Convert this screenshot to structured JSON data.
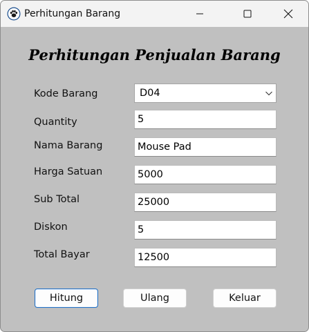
{
  "window": {
    "title": "Perhitungan Barang",
    "icon": "paw-icon",
    "controls": [
      "minimize-icon",
      "maximize-icon",
      "close-icon"
    ]
  },
  "form": {
    "heading": "Perhitungan Penjualan Barang",
    "fields": {
      "kode_barang": {
        "label": "Kode Barang",
        "value": "D04"
      },
      "quantity": {
        "label": "Quantity",
        "value": "5"
      },
      "nama_barang": {
        "label": "Nama Barang",
        "value": "Mouse Pad"
      },
      "harga_satuan": {
        "label": "Harga Satuan",
        "value": "5000"
      },
      "sub_total": {
        "label": "Sub Total",
        "value": "25000"
      },
      "diskon": {
        "label": "Diskon",
        "value": "5"
      },
      "total_bayar": {
        "label": "Total Bayar",
        "value": "12500"
      }
    }
  },
  "buttons": {
    "hitung": "Hitung",
    "ulang": "Ulang",
    "keluar": "Keluar"
  },
  "colors": {
    "window_background": "#c0c0c0",
    "titlebar": "#f3f3f3",
    "focus_border": "#1f6fc5"
  }
}
